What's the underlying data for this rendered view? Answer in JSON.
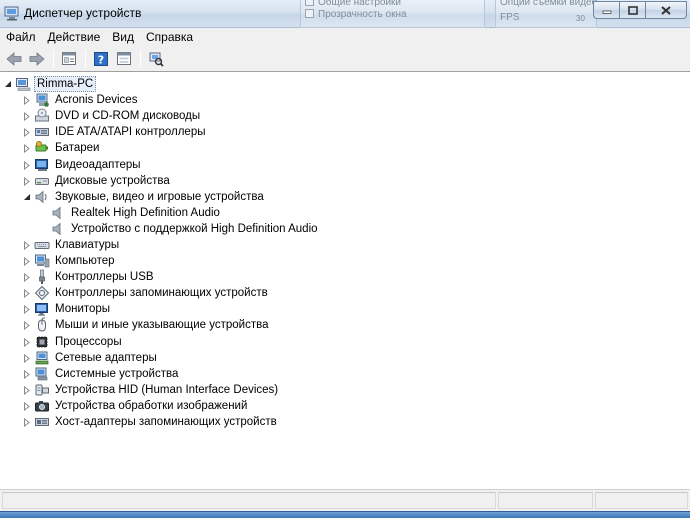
{
  "window": {
    "title": "Диспетчер устройств",
    "background_ghost": {
      "panel1_line1": "Общие настройки",
      "panel1_line2": "Прозрачность окна",
      "panel2_line1": "Опции съемки видео",
      "panel2_line2": "FPS",
      "panel2_value": "30"
    }
  },
  "menu": {
    "items": [
      "Файл",
      "Действие",
      "Вид",
      "Справка"
    ]
  },
  "toolbar": {
    "buttons": [
      "back-icon",
      "forward-icon",
      "properties-icon",
      "help-icon",
      "view-icon",
      "scan-hardware-icon"
    ]
  },
  "tree": {
    "root": "Rimma-PC",
    "categories": [
      {
        "label": "Acronis Devices",
        "icon": "acronis-device-icon"
      },
      {
        "label": "DVD и CD-ROM дисководы",
        "icon": "dvd-drive-icon"
      },
      {
        "label": "IDE ATA/ATAPI контроллеры",
        "icon": "ide-controller-icon"
      },
      {
        "label": "Батареи",
        "icon": "battery-icon"
      },
      {
        "label": "Видеоадаптеры",
        "icon": "display-adapter-icon"
      },
      {
        "label": "Дисковые устройства",
        "icon": "disk-drive-icon"
      },
      {
        "label": "Звуковые, видео и игровые устройства",
        "icon": "sound-device-icon",
        "expanded": true,
        "children": [
          "Realtek High Definition Audio",
          "Устройство с поддержкой High Definition Audio"
        ]
      },
      {
        "label": "Клавиатуры",
        "icon": "keyboard-icon"
      },
      {
        "label": "Компьютер",
        "icon": "computer-icon"
      },
      {
        "label": "Контроллеры USB",
        "icon": "usb-icon"
      },
      {
        "label": "Контроллеры запоминающих устройств",
        "icon": "storage-controller-icon"
      },
      {
        "label": "Мониторы",
        "icon": "monitor-icon"
      },
      {
        "label": "Мыши и иные указывающие устройства",
        "icon": "mouse-icon"
      },
      {
        "label": "Процессоры",
        "icon": "processor-icon"
      },
      {
        "label": "Сетевые адаптеры",
        "icon": "network-adapter-icon"
      },
      {
        "label": "Системные устройства",
        "icon": "system-device-icon"
      },
      {
        "label": "Устройства HID (Human Interface Devices)",
        "icon": "hid-icon"
      },
      {
        "label": "Устройства обработки изображений",
        "icon": "imaging-device-icon"
      },
      {
        "label": "Хост-адаптеры запоминающих устройств",
        "icon": "storage-host-adapter-icon"
      }
    ]
  },
  "colors": {
    "title_gradient_top": "#e6eef7",
    "selection_fill": "#e6eef8",
    "toolbar_bg": "#f0f0f0"
  }
}
